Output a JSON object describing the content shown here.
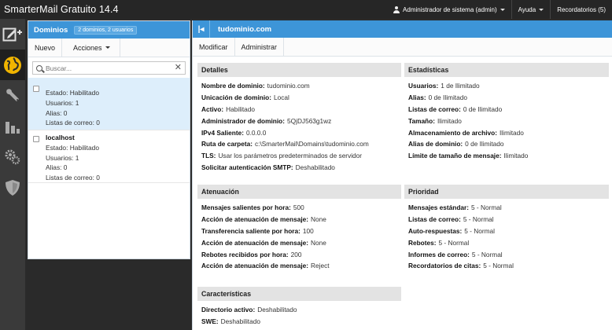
{
  "app": {
    "title": "SmarterMail Gratuito 14.4"
  },
  "top": {
    "user": "Administrador de sistema (admin)",
    "help": "Ayuda",
    "reminders": "Recordatorios (5)"
  },
  "rail": [
    "compose-icon",
    "globe-icon",
    "wrench-icon",
    "reports-icon",
    "settings-icon",
    "security-icon"
  ],
  "domains": {
    "title": "Dominios",
    "badge": "2 dominios, 2 usuarios",
    "new_label": "Nuevo",
    "actions_label": "Acciones",
    "search_placeholder": "Buscar...",
    "items": [
      {
        "name": "",
        "status": "Estado: Habilitado",
        "users": "Usuarios: 1",
        "aliases": "Alias: 0",
        "lists": "Listas de correo: 0"
      },
      {
        "name": "localhost",
        "status": "Estado: Habilitado",
        "users": "Usuarios: 1",
        "aliases": "Alias: 0",
        "lists": "Listas de correo: 0"
      }
    ]
  },
  "detail": {
    "title": "tudominio.com",
    "modify_label": "Modificar",
    "admin_label": "Administrar",
    "details": {
      "title": "Detalles",
      "rows": [
        {
          "k": "Nombre de dominio:",
          "v": "tudominio.com"
        },
        {
          "k": "Unicación de dominio:",
          "v": "Local"
        },
        {
          "k": "Activo:",
          "v": "Habilitado"
        },
        {
          "k": "Administrador de dominio:",
          "v": "5QjDJ563g1wz"
        },
        {
          "k": "IPv4 Saliente:",
          "v": "0.0.0.0"
        },
        {
          "k": "Ruta de carpeta:",
          "v": "c:\\SmarterMail\\Domains\\tudominio.com"
        },
        {
          "k": "TLS:",
          "v": "Usar los parámetros predeterminados de servidor"
        },
        {
          "k": "Solicitar autenticación SMTP:",
          "v": "Deshabilitado"
        }
      ]
    },
    "stats": {
      "title": "Estadísticas",
      "rows": [
        {
          "k": "Usuarios:",
          "v": "1 de Ilimitado"
        },
        {
          "k": "Alias:",
          "v": "0 de Ilimitado"
        },
        {
          "k": "Listas de correo:",
          "v": "0 de Ilimitado"
        },
        {
          "k": "Tamaño:",
          "v": "Ilimitado"
        },
        {
          "k": "Almacenamiento de archivo:",
          "v": "Ilimitado"
        },
        {
          "k": "Alias de dominio:",
          "v": "0 de Ilimitado"
        },
        {
          "k": "Límite de tamaño de mensaje:",
          "v": "Ilimitado"
        }
      ]
    },
    "throttle": {
      "title": "Atenuación",
      "rows": [
        {
          "k": "Mensajes salientes por hora:",
          "v": "500"
        },
        {
          "k": "Acción de atenuación de mensaje:",
          "v": "None"
        },
        {
          "k": "Transferencia saliente por hora:",
          "v": "100"
        },
        {
          "k": "Acción de atenuación de mensaje:",
          "v": "None"
        },
        {
          "k": "Rebotes recibidos por hora:",
          "v": "200"
        },
        {
          "k": "Acción de atenuación de mensaje:",
          "v": "Reject"
        }
      ]
    },
    "priority": {
      "title": "Prioridad",
      "rows": [
        {
          "k": "Mensajes estándar:",
          "v": "5 - Normal"
        },
        {
          "k": "Listas de correo:",
          "v": "5 - Normal"
        },
        {
          "k": "Auto-respuestas:",
          "v": "5 - Normal"
        },
        {
          "k": "Rebotes:",
          "v": "5 - Normal"
        },
        {
          "k": "Informes de correo:",
          "v": "5 - Normal"
        },
        {
          "k": "Recordatorios de citas:",
          "v": "5 - Normal"
        }
      ]
    },
    "features": {
      "title": "Características",
      "rows": [
        {
          "k": "Directorio activo:",
          "v": "Deshabilitado"
        },
        {
          "k": "SWE:",
          "v": "Deshabilitado"
        }
      ]
    }
  }
}
